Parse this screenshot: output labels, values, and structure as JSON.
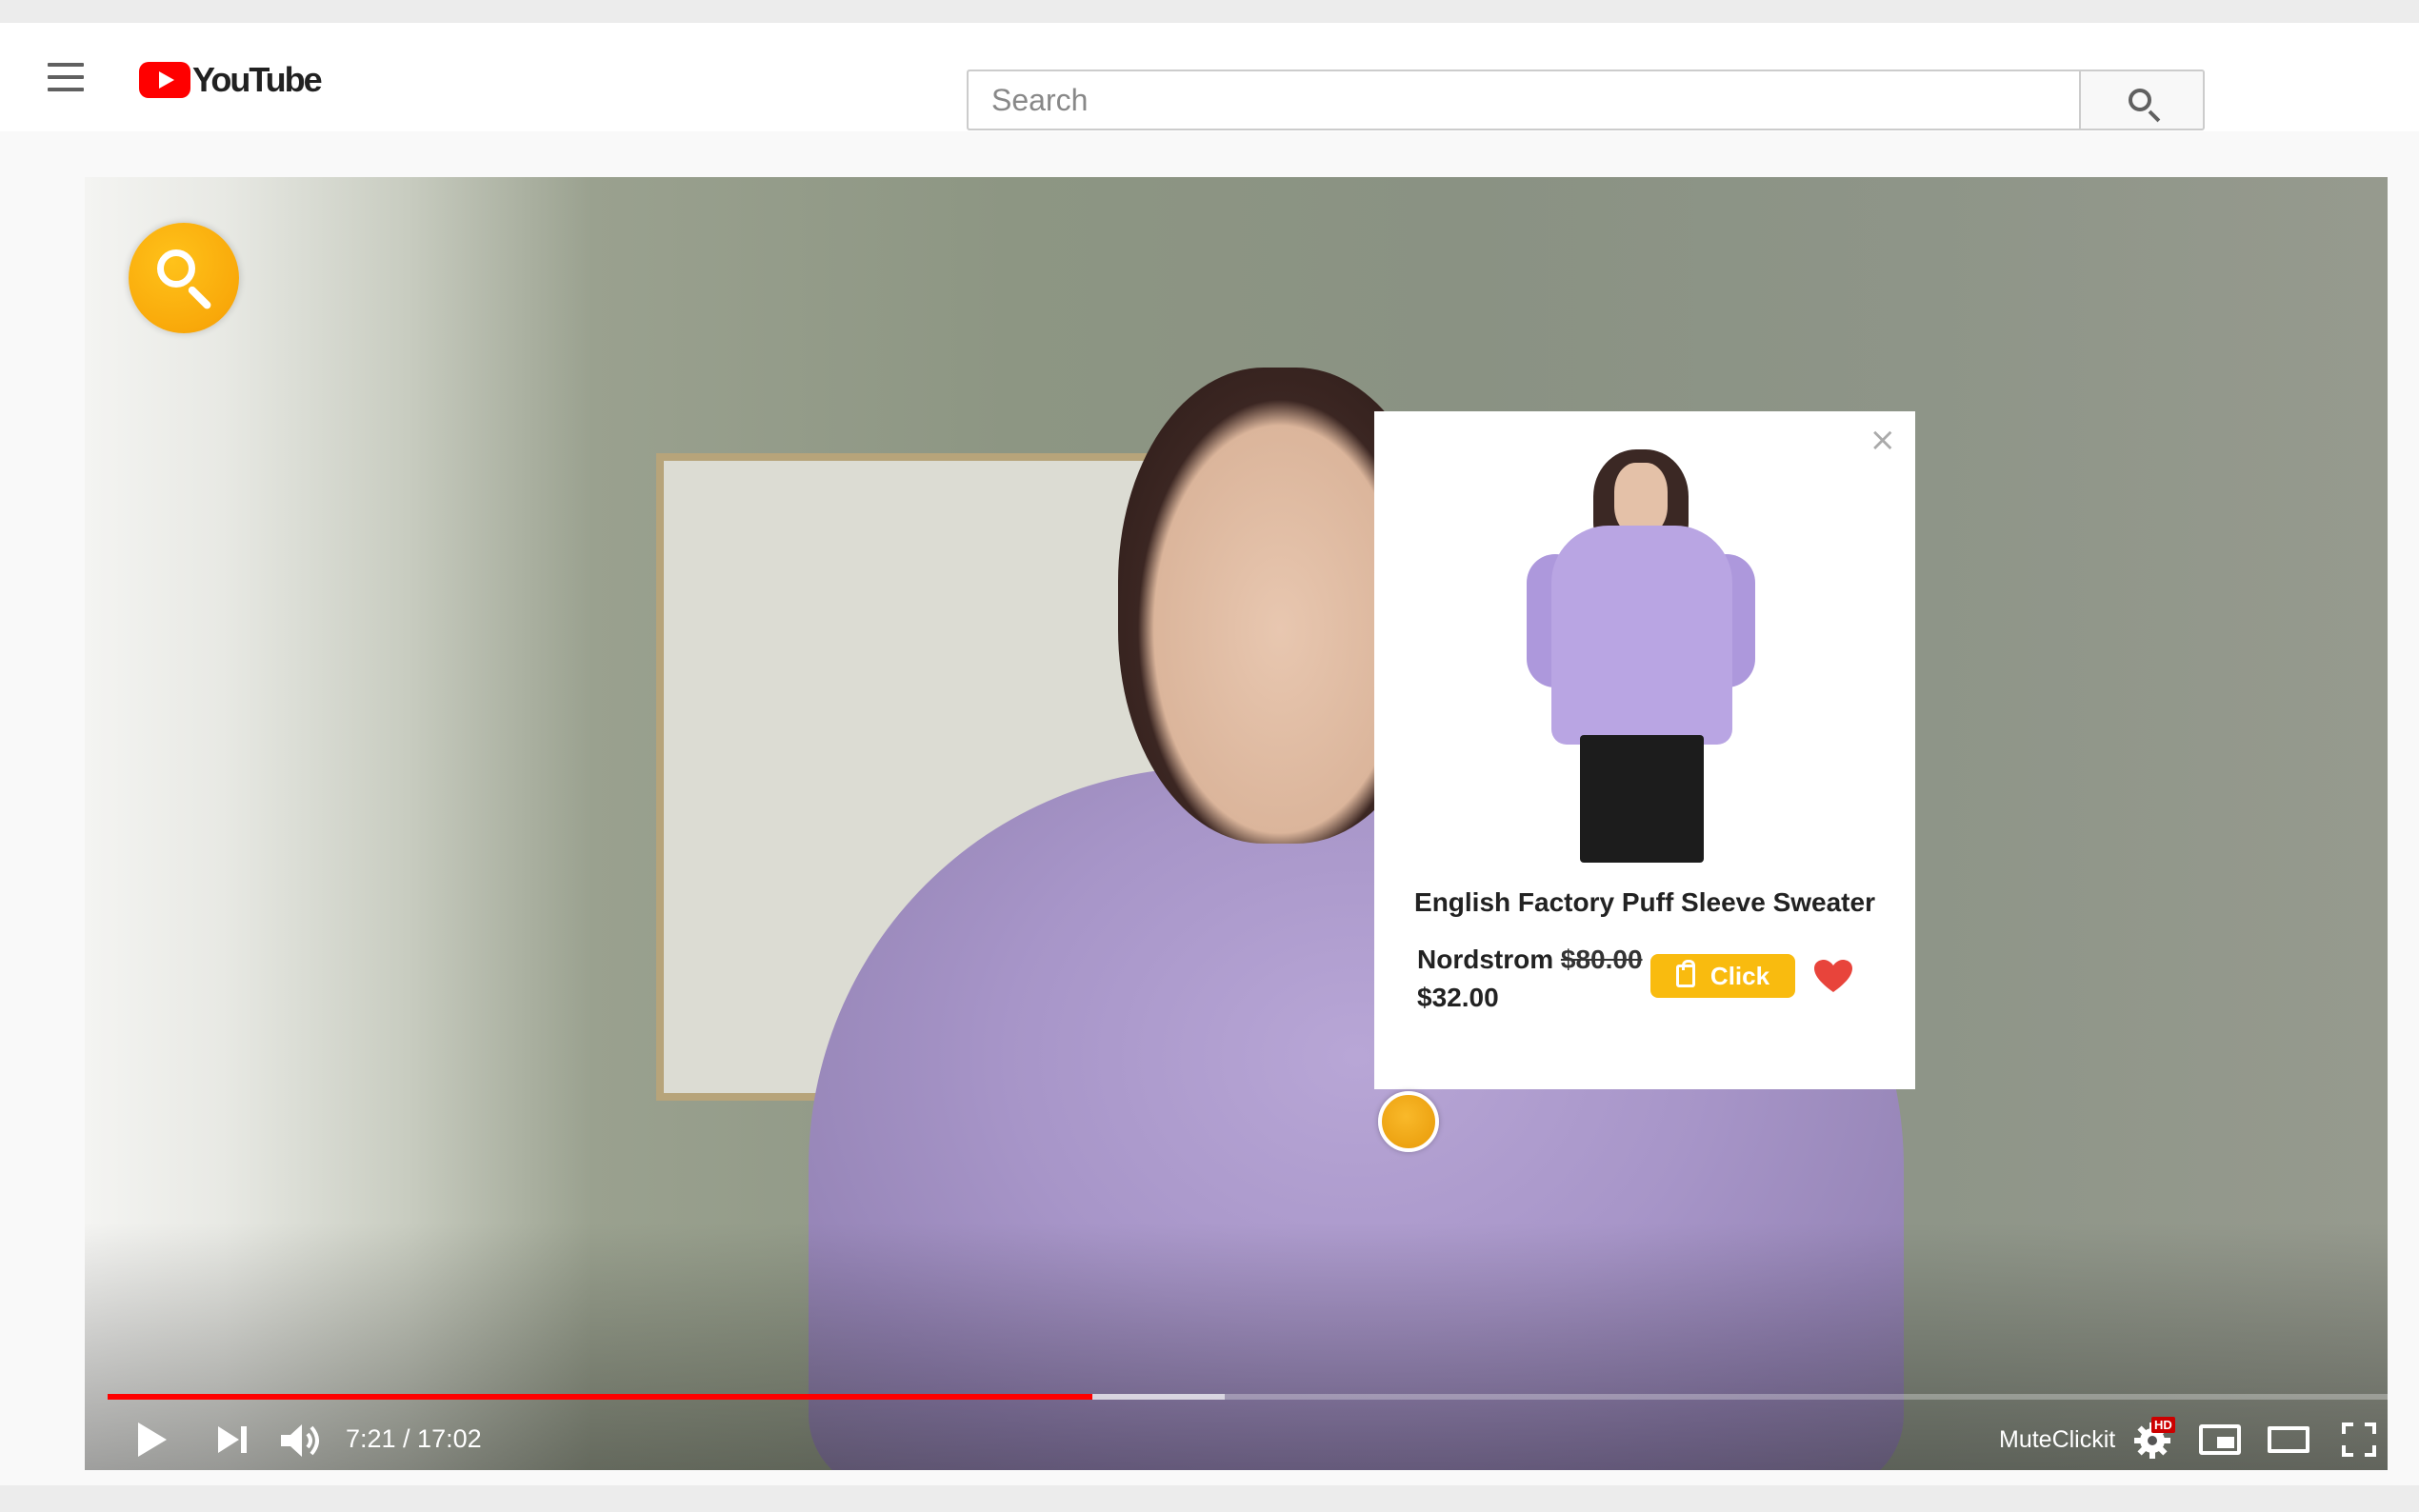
{
  "header": {
    "logo_text": "YouTube",
    "search_placeholder": "Search"
  },
  "player": {
    "time": "7:21 / 17:02",
    "progress_played_fraction": 0.432,
    "progress_buffered_fraction": 0.49,
    "extension_label": "MuteClickit",
    "hd_badge": "HD",
    "accent_colors": {
      "progress": "#ff0000",
      "overlay_yellow": "#f9bb0f"
    }
  },
  "product_card": {
    "title": "English Factory Puff Sleeve Sweater",
    "store": "Nordstrom",
    "old_price": "$80.00",
    "price": "$32.00",
    "button_label": "Click",
    "close_label": "×"
  },
  "icons": [
    "menu-icon",
    "youtube-logo-icon",
    "search-icon",
    "overlay-search-icon",
    "close-icon",
    "shopping-bag-icon",
    "heart-icon",
    "play-icon",
    "next-icon",
    "volume-icon",
    "settings-icon",
    "miniplayer-icon",
    "theater-icon",
    "fullscreen-icon"
  ]
}
